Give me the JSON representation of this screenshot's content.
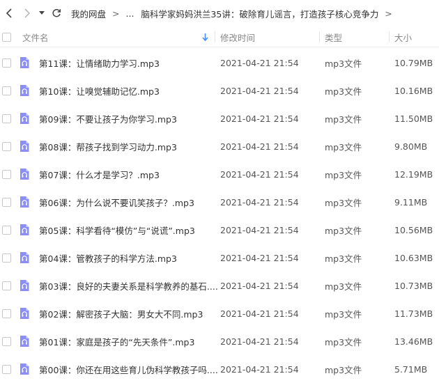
{
  "nav": {
    "back_icon": "chevron-left-icon",
    "forward_icon": "chevron-right-icon",
    "dropdown_icon": "caret-down-icon",
    "refresh_icon": "refresh-icon",
    "breadcrumb": [
      "我的网盘",
      "...",
      "脑科学家妈妈洪兰35讲：破除育儿谣言，打造孩子核心竞争力"
    ],
    "separator": ">"
  },
  "columns": {
    "name": "文件名",
    "sort_icon": "arrow-down-icon",
    "modified": "修改时间",
    "type": "类型",
    "size": "大小"
  },
  "colors": {
    "file_icon": "#8b8ff5",
    "sort_arrow": "#3b8cff"
  },
  "files": [
    {
      "name": "第11课：让情绪助力学习.mp3",
      "modified": "2021-04-21 21:54",
      "type": "mp3文件",
      "size": "10.79MB"
    },
    {
      "name": "第10课：让嗅觉辅助记忆.mp3",
      "modified": "2021-04-21 21:54",
      "type": "mp3文件",
      "size": "10.16MB"
    },
    {
      "name": "第09课：不要让孩子为你学习.mp3",
      "modified": "2021-04-21 21:54",
      "type": "mp3文件",
      "size": "11.50MB"
    },
    {
      "name": "第08课：帮孩子找到学习动力.mp3",
      "modified": "2021-04-21 21:54",
      "type": "mp3文件",
      "size": "9.80MB"
    },
    {
      "name": "第07课：什么才是学习？.mp3",
      "modified": "2021-04-21 21:54",
      "type": "mp3文件",
      "size": "12.19MB"
    },
    {
      "name": "第06课：为什么说不要讥笑孩子？.mp3",
      "modified": "2021-04-21 21:54",
      "type": "mp3文件",
      "size": "9.11MB"
    },
    {
      "name": "第05课：科学看待“模仿”与“说谎”.mp3",
      "modified": "2021-04-21 21:54",
      "type": "mp3文件",
      "size": "10.56MB"
    },
    {
      "name": "第04课：管教孩子的科学方法.mp3",
      "modified": "2021-04-21 21:54",
      "type": "mp3文件",
      "size": "10.63MB"
    },
    {
      "name": "第03课：良好的夫妻关系是科学教养的基石....",
      "modified": "2021-04-21 21:54",
      "type": "mp3文件",
      "size": "10.73MB"
    },
    {
      "name": "第02课：解密孩子大脑：男女大不同.mp3",
      "modified": "2021-04-21 21:54",
      "type": "mp3文件",
      "size": "11.73MB"
    },
    {
      "name": "第01课：家庭是孩子的“先天条件”.mp3",
      "modified": "2021-04-21 21:54",
      "type": "mp3文件",
      "size": "13.46MB"
    },
    {
      "name": "第00课：你还在用这些育儿伪科学教孩子吗....",
      "modified": "2021-04-21 21:54",
      "type": "mp3文件",
      "size": "5.71MB"
    }
  ]
}
